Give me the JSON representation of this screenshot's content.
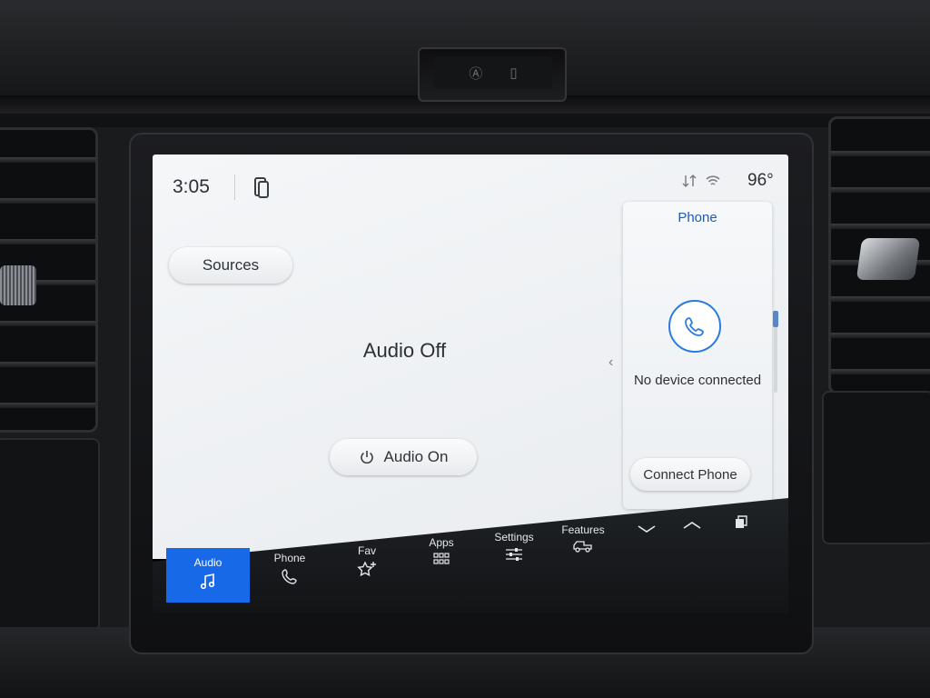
{
  "status_bar": {
    "time": "3:05",
    "temperature": "96°"
  },
  "main": {
    "sources_label": "Sources",
    "audio_status": "Audio Off",
    "audio_on_label": "Audio On"
  },
  "phone_card": {
    "title": "Phone",
    "message": "No device connected",
    "connect_label": "Connect Phone"
  },
  "nav": {
    "items": [
      {
        "label": "Audio",
        "icon": "music-note-icon",
        "active": true
      },
      {
        "label": "Phone",
        "icon": "phone-icon",
        "active": false
      },
      {
        "label": "Fav",
        "icon": "star-plus-icon",
        "active": false
      },
      {
        "label": "Apps",
        "icon": "grid-icon",
        "active": false
      },
      {
        "label": "Settings",
        "icon": "sliders-icon",
        "active": false
      },
      {
        "label": "Features",
        "icon": "truck-icon",
        "active": false
      }
    ]
  },
  "colors": {
    "accent": "#1869e8",
    "phone_title": "#1f5bb6",
    "screen_bg": "#f0f2f4",
    "nav_bg": "#1c1f23"
  }
}
